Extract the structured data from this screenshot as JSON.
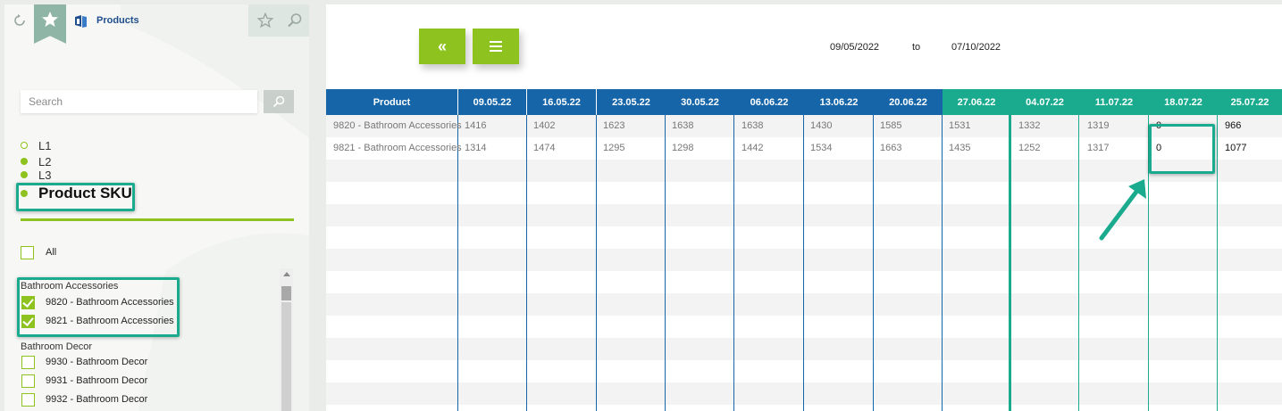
{
  "app": {
    "title": "Products"
  },
  "icons": {
    "refresh": "refresh-icon",
    "favorite": "star-icon",
    "products": "products-icon",
    "favorite_tool": "star-outline-icon",
    "search_tool": "search-icon"
  },
  "colors": {
    "accent_green": "#8dc21f",
    "teal": "#1aab8e",
    "blue": "#1565a8",
    "title_blue": "#1f4e8c"
  },
  "search": {
    "placeholder": "Search"
  },
  "levels": [
    {
      "label": "L1",
      "selected": false
    },
    {
      "label": "L2",
      "selected": true
    },
    {
      "label": "L3",
      "selected": true
    },
    {
      "label": "Product SKU",
      "selected": true
    }
  ],
  "filters": {
    "all_label": "All",
    "groups": [
      {
        "name": "Bathroom Accessories",
        "items": [
          {
            "label": "9820 - Bathroom Accessories",
            "checked": true
          },
          {
            "label": "9821 - Bathroom Accessories",
            "checked": true
          }
        ]
      },
      {
        "name": "Bathroom Decor",
        "items": [
          {
            "label": "9930 - Bathroom Decor",
            "checked": false
          },
          {
            "label": "9931 - Bathroom Decor",
            "checked": false
          },
          {
            "label": "9932 - Bathroom Decor",
            "checked": false
          }
        ]
      }
    ]
  },
  "toolbar": {
    "collapse_label": "«",
    "menu_icon": "menu-icon"
  },
  "date_range": {
    "from": "09/05/2022",
    "to_label": "to",
    "to": "07/10/2022"
  },
  "table": {
    "product_header": "Product",
    "columns": [
      "09.05.22",
      "16.05.22",
      "23.05.22",
      "30.05.22",
      "06.06.22",
      "13.06.22",
      "20.06.22",
      "27.06.22",
      "04.07.22",
      "11.07.22",
      "18.07.22",
      "25.07.22"
    ],
    "rows": [
      {
        "product": "9820 - Bathroom Accessories",
        "values": [
          "1416",
          "1402",
          "1623",
          "1638",
          "1638",
          "1430",
          "1585",
          "1531",
          "1332",
          "1319",
          "0",
          "966"
        ]
      },
      {
        "product": "9821 - Bathroom Accessories",
        "values": [
          "1314",
          "1474",
          "1295",
          "1298",
          "1442",
          "1534",
          "1663",
          "1435",
          "1252",
          "1317",
          "0",
          "1077"
        ]
      }
    ]
  }
}
